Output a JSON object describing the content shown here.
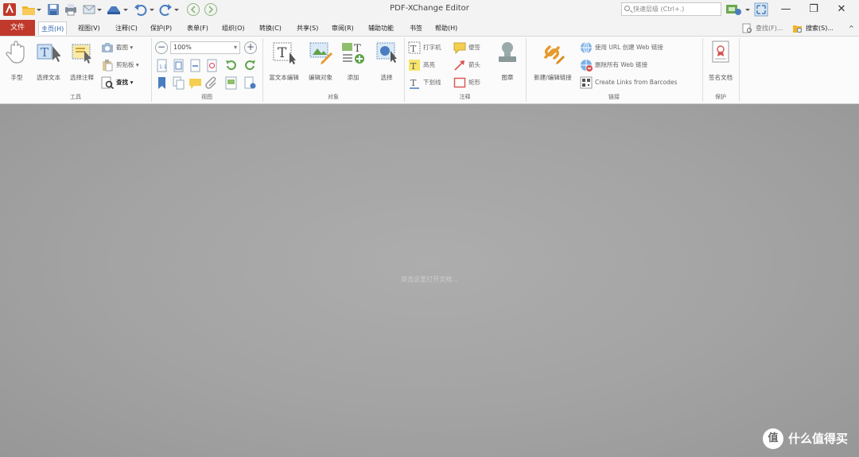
{
  "window": {
    "title": "PDF-XChange Editor",
    "search_placeholder": "快速层级 (Ctrl+.)",
    "minimize": "—",
    "restore": "❐",
    "close": "✕"
  },
  "menu": {
    "file": "文件",
    "items": [
      "主页(H)",
      "视图(V)",
      "注释(C)",
      "保护(P)",
      "表单(F)",
      "组织(O)",
      "转换(C)",
      "共享(S)",
      "审阅(R)",
      "辅助功能",
      "书签",
      "帮助(H)"
    ],
    "collapse": "^",
    "find": "查找(F)...",
    "search": "搜索(S)..."
  },
  "ribbon": {
    "tools": {
      "hand": "手型",
      "select_text": "选择文本",
      "select_comments": "选择注释",
      "snapshot": "截图",
      "clipboard": "剪贴板",
      "find": "查找",
      "group": "工具"
    },
    "view": {
      "zoom": "100%",
      "group": "视图"
    },
    "objects": {
      "edit_text": "富文本编辑",
      "edit_objects": "编辑对象",
      "add": "添加",
      "select": "选择",
      "group": "对象"
    },
    "comments": {
      "typewriter": "打字机",
      "sticky_note": "便签",
      "highlight": "高亮",
      "arrow": "箭头",
      "underline": "下划线",
      "rectangle": "矩形",
      "stamp": "图章",
      "group": "注释"
    },
    "links": {
      "new_link": "新建/编辑链接",
      "create_web_links": "使用 URL 创建 Web 链接",
      "remove_web_links": "删除所有 Web 链接",
      "links_from_barcodes": "Create Links from Barcodes",
      "group": "链接"
    },
    "protect": {
      "sign": "签名文档",
      "group": "保护"
    }
  },
  "workspace": {
    "hint": "双击这里打开文档...",
    "watermark": "什么值得买"
  },
  "colors": {
    "file_tab": "#c0392b",
    "accent": "#2a5fa8",
    "workspace": "#a5a5a5"
  }
}
